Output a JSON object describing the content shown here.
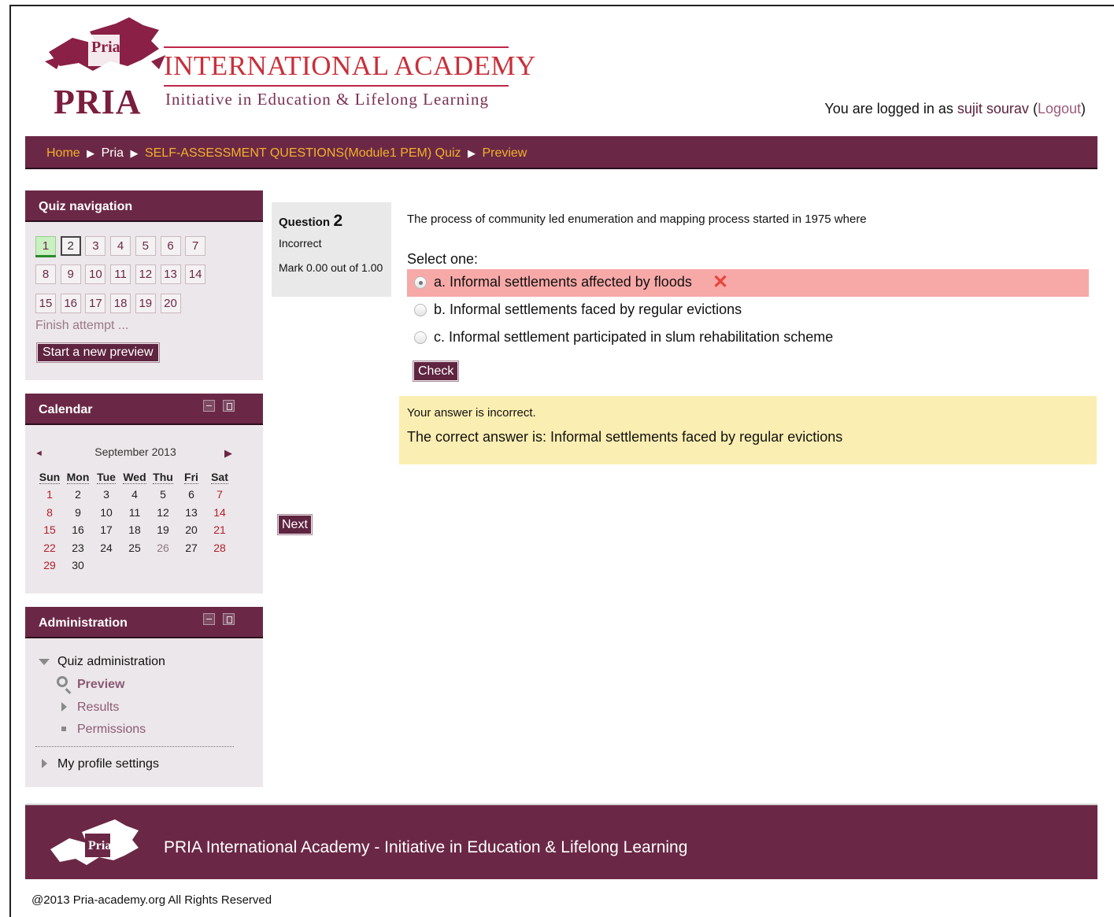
{
  "header": {
    "logo_monogram": "Pria",
    "logo_wordmark": "PRIA",
    "academy_name": "INTERNATIONAL ACADEMY",
    "tagline": "Initiative in Education & Lifelong Learning",
    "login_prefix": "You are logged in as",
    "user_name": "sujit sourav",
    "logout_open": "(",
    "logout_label": "Logout",
    "logout_close": ")"
  },
  "breadcrumb": {
    "items": [
      {
        "label": "Home"
      },
      {
        "label": "Pria"
      },
      {
        "label": "SELF-ASSESSMENT QUESTIONS(Module1 PEM) Quiz"
      },
      {
        "label": "Preview"
      }
    ],
    "separator": "▶"
  },
  "quiz_nav": {
    "title": "Quiz navigation",
    "questions": [
      "1",
      "2",
      "3",
      "4",
      "5",
      "6",
      "7",
      "8",
      "9",
      "10",
      "11",
      "12",
      "13",
      "14",
      "15",
      "16",
      "17",
      "18",
      "19",
      "20"
    ],
    "finish_label": "Finish attempt ...",
    "new_preview_label": "Start a new preview"
  },
  "calendar": {
    "title": "Calendar",
    "month": "September 2013",
    "prev": "◄",
    "next": "▶",
    "weekdays": [
      "Sun",
      "Mon",
      "Tue",
      "Wed",
      "Thu",
      "Fri",
      "Sat"
    ],
    "weeks": [
      [
        "1",
        "2",
        "3",
        "4",
        "5",
        "6",
        "7"
      ],
      [
        "8",
        "9",
        "10",
        "11",
        "12",
        "13",
        "14"
      ],
      [
        "15",
        "16",
        "17",
        "18",
        "19",
        "20",
        "21"
      ],
      [
        "22",
        "23",
        "24",
        "25",
        "26",
        "27",
        "28"
      ],
      [
        "29",
        "30",
        "",
        "",
        "",
        "",
        ""
      ]
    ]
  },
  "administration": {
    "title": "Administration",
    "quiz_admin_label": "Quiz administration",
    "preview_label": "Preview",
    "results_label": "Results",
    "permissions_label": "Permissions",
    "profile_label": "My profile settings"
  },
  "question": {
    "label": "Question",
    "number": "2",
    "state": "Incorrect",
    "mark": "Mark 0.00 out of 1.00",
    "text": "The process of community led enumeration and mapping process started in 1975 where",
    "prompt": "Select one:",
    "options": [
      {
        "label": "a. Informal settlements affected by floods"
      },
      {
        "label": "b. Informal settlements faced by regular evictions"
      },
      {
        "label": "c. Informal settlement participated in slum rehabilitation scheme"
      }
    ],
    "incorrect_mark": "✕",
    "check_label": "Check",
    "feedback_status": "Your answer is incorrect.",
    "correct_answer": "The correct answer is: Informal settlements faced by regular evictions",
    "next_label": "Next"
  },
  "footer": {
    "text": "PRIA International Academy - Initiative in Education & Lifelong Learning",
    "copyright": "@2013 Pria-academy.org All Rights Reserved"
  },
  "colors": {
    "brand_maroon": "#6b2846",
    "link_gold": "#f2b12a",
    "incorrect_bg": "#f7a9a8",
    "feedback_bg": "#fbeeb2",
    "answered_green": "#c8f0c0"
  }
}
